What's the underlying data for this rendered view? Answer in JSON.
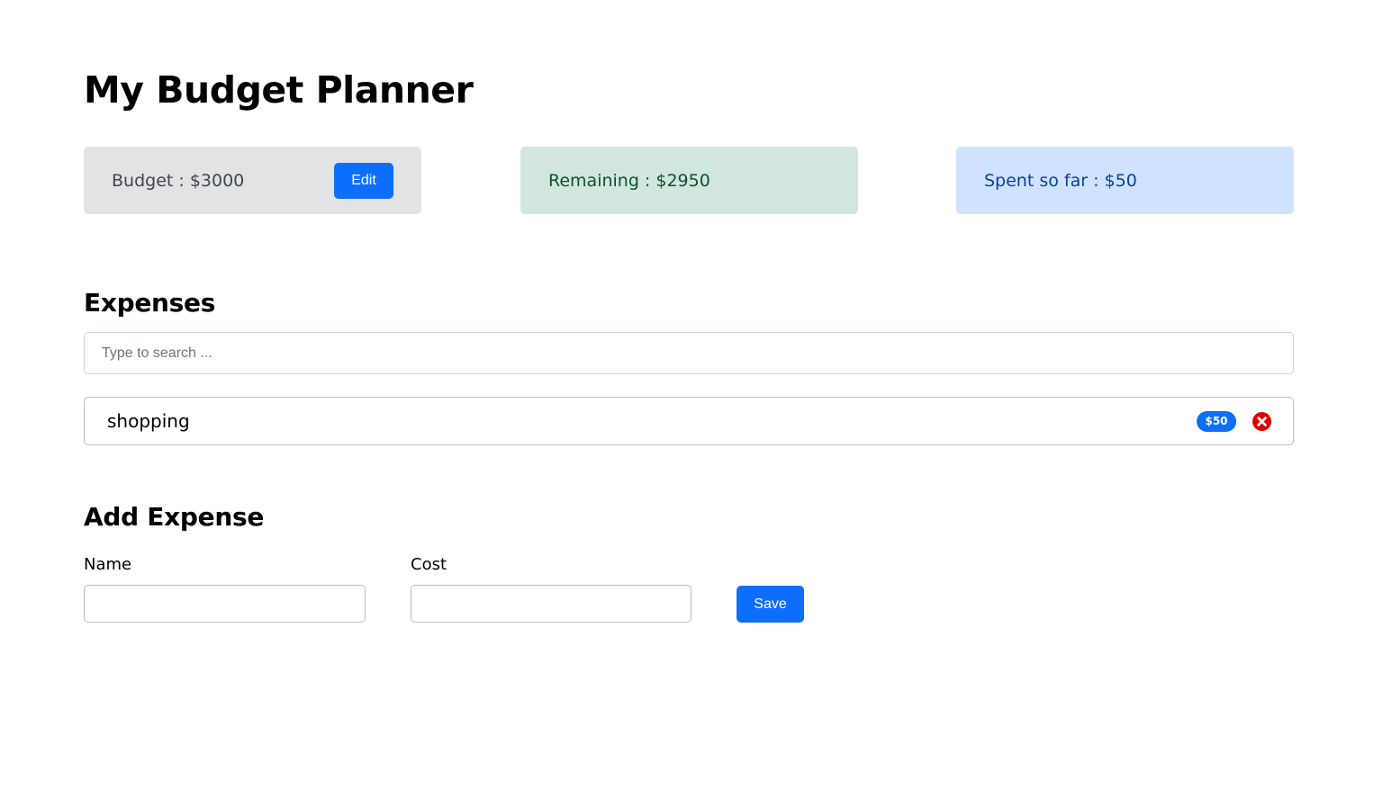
{
  "app": {
    "title": "My Budget Planner"
  },
  "summary": {
    "budget_text": "Budget : $3000",
    "edit_label": "Edit",
    "remaining_text": "Remaining : $2950",
    "spent_text": "Spent so far : $50"
  },
  "expenses": {
    "title": "Expenses",
    "search_placeholder": "Type to search ...",
    "items": [
      {
        "name": "shopping",
        "cost": "$50"
      }
    ]
  },
  "add_expense": {
    "title": "Add Expense",
    "name_label": "Name",
    "cost_label": "Cost",
    "name_value": "",
    "cost_value": "",
    "save_label": "Save"
  },
  "colors": {
    "primary": "#0d6efd",
    "budget_bg": "#e2e3e5",
    "remaining_bg": "#d1e7dd",
    "spent_bg": "#cfe2ff",
    "delete": "#e00000"
  },
  "icons": {
    "delete": "x-circle-icon"
  }
}
